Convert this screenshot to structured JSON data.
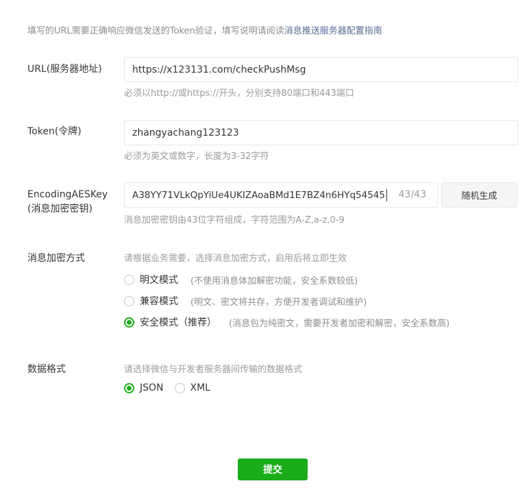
{
  "tips": {
    "text": "填写的URL需要正确响应微信发送的Token验证，填写说明请阅读",
    "link": "消息推送服务器配置指南"
  },
  "url": {
    "label": "URL(服务器地址)",
    "value": "https://x123131.com/checkPushMsg",
    "hint": "必须以http://或https://开头，分别支持80端口和443端口"
  },
  "token": {
    "label": "Token(令牌)",
    "value": "zhangyachang123123",
    "hint": "必须为英文或数字，长度为3-32字符"
  },
  "aes": {
    "label_line1": "EncodingAESKey",
    "label_line2": "(消息加密密钥)",
    "value": "A38YY71VLkQpYiUe4UKIZAoaBMd1E7BZ4n6HYq54545",
    "counter": "43/43",
    "random_button": "随机生成",
    "hint": "消息加密密钥由43位字符组成，字符范围为A-Z,a-z,0-9"
  },
  "encryption": {
    "label": "消息加密方式",
    "hint": "请根据业务需要，选择消息加密方式，启用后将立即生效",
    "options": [
      {
        "label": "明文模式",
        "desc": "(不使用消息体加解密功能，安全系数较低)",
        "checked": false
      },
      {
        "label": "兼容模式",
        "desc": "(明文、密文将共存，方便开发者调试和维护)",
        "checked": false
      },
      {
        "label": "安全模式（推荐）",
        "desc": "(消息包为纯密文，需要开发者加密和解密，安全系数高)",
        "checked": true
      }
    ]
  },
  "format": {
    "label": "数据格式",
    "hint": "请选择微信与开发者服务器间传输的数据格式",
    "options": [
      {
        "label": "JSON",
        "checked": true
      },
      {
        "label": "XML",
        "checked": false
      }
    ]
  },
  "submit_label": "提交",
  "accent_color": "#1aad19",
  "link_color": "#576b95"
}
